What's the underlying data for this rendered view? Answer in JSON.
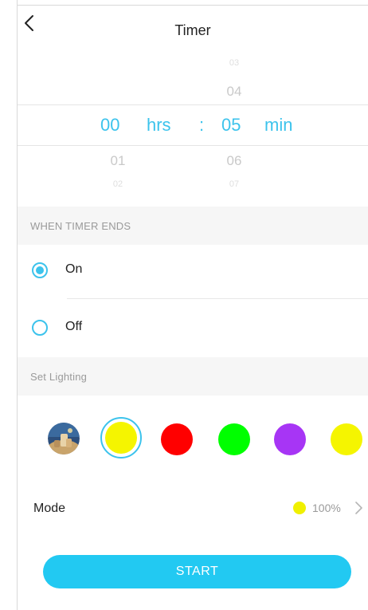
{
  "header": {
    "title": "Timer"
  },
  "picker": {
    "hours": {
      "prev_far": "",
      "prev": "",
      "selected": "00",
      "next": "01",
      "next_far": "02"
    },
    "minutes": {
      "prev_far": "03",
      "prev": "04",
      "selected": "05",
      "next": "06",
      "next_far": "07"
    },
    "hrs_unit": "hrs",
    "separator": ":",
    "min_unit": "min"
  },
  "when_timer_ends": {
    "section_label": "WHEN TIMER ENDS",
    "options": [
      {
        "label": "On",
        "selected": true
      },
      {
        "label": "Off",
        "selected": false
      }
    ]
  },
  "lighting": {
    "section_label": "Set Lighting",
    "swatches": [
      {
        "kind": "scene-photo"
      },
      {
        "color": "#f5f500",
        "selected": true
      },
      {
        "color": "#ff0000",
        "selected": false
      },
      {
        "color": "#00ff00",
        "selected": false
      },
      {
        "color": "#a735f5",
        "selected": false
      },
      {
        "color": "#f5f500",
        "selected": false
      }
    ]
  },
  "mode": {
    "label": "Mode",
    "color": "#f0f000",
    "brightness": "100%"
  },
  "start_button": {
    "label": "START"
  },
  "accent_color": "#3cc3ec"
}
